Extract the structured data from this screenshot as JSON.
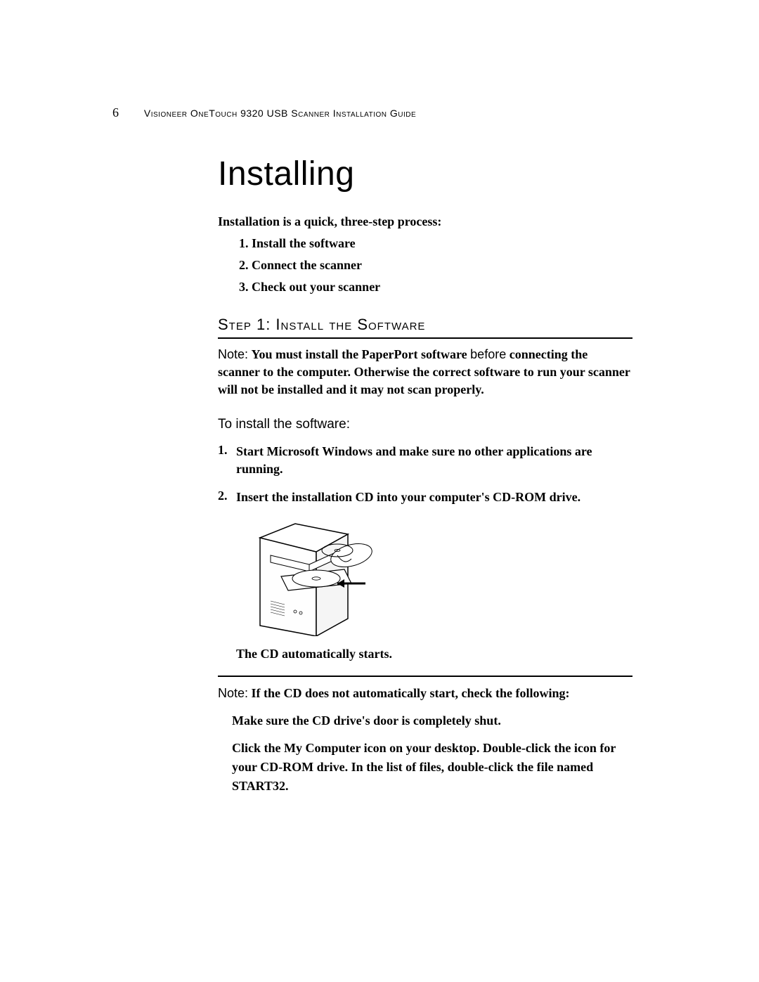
{
  "header": {
    "page_number": "6",
    "running_title": "Visioneer OneTouch 9320 USB Scanner Installation Guide"
  },
  "chapter_title": "Installing",
  "intro": "Installation is a quick, three-step process:",
  "overview_steps": [
    "1. Install the software",
    "2. Connect the scanner",
    "3. Check out your scanner"
  ],
  "section_head": "Step 1: Install the Software",
  "note1": {
    "label": "Note:",
    "part1": "You must install the PaperPort software ",
    "emph": "before",
    "part2": " connecting the scanner to the computer. Otherwise the correct software to run your scanner will not be installed and it may not scan properly."
  },
  "subtask_head": "To install the software:",
  "steps": [
    {
      "num": "1.",
      "text": "Start Microsoft Windows and make sure no other applications are running."
    },
    {
      "num": "2.",
      "text": "Insert the installation CD into your computer's CD-ROM drive."
    }
  ],
  "caption": "The CD automatically starts.",
  "note2": {
    "label": "Note:",
    "lead": "If the CD does not automatically start, check the following:",
    "bullets": [
      "Make sure the CD drive's door is completely shut.",
      "Click the My Computer icon on your desktop. Double-click the icon for your CD-ROM drive. In the list of files, double-click the file named START32."
    ]
  }
}
